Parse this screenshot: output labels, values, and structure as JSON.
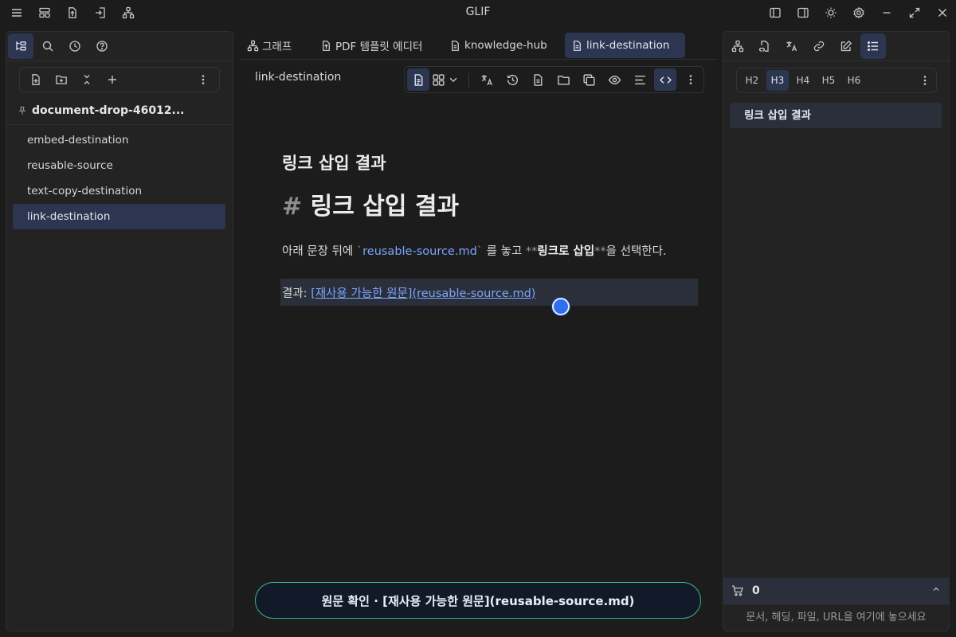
{
  "app": {
    "title": "GLIF"
  },
  "titlebar": {
    "left_icons": [
      "menu-icon",
      "layout-icon",
      "export-icon",
      "import-icon",
      "hierarchy-icon"
    ],
    "right_icons": [
      "left-sidebar-icon",
      "right-sidebar-icon",
      "theme-icon",
      "settings-icon",
      "minimize-icon",
      "maximize-icon",
      "close-icon"
    ]
  },
  "left_panel": {
    "tabs": [
      "file-tree-icon",
      "search-icon",
      "history-icon",
      "help-icon"
    ],
    "toolbar": [
      "new-file-icon",
      "new-folder-icon",
      "collapse-icon",
      "add-icon",
      "more-icon"
    ],
    "vault": {
      "name": "document-drop-46012..."
    },
    "files": [
      {
        "label": "embed-destination",
        "active": false
      },
      {
        "label": "reusable-source",
        "active": false
      },
      {
        "label": "text-copy-destination",
        "active": false
      },
      {
        "label": "link-destination",
        "active": true
      }
    ]
  },
  "tabs": [
    {
      "label": "그래프",
      "icon": "graph-icon",
      "active": false
    },
    {
      "label": "PDF 템플릿 에디터",
      "icon": "pdf-icon",
      "active": false
    },
    {
      "label": "knowledge-hub",
      "icon": "document-icon",
      "active": false
    },
    {
      "label": "link-destination",
      "icon": "document-icon",
      "active": true
    }
  ],
  "document": {
    "header_title": "link-destination",
    "toolbar": [
      "document-icon",
      "grid-icon",
      "chevron-down-icon",
      "translate-icon",
      "history-icon",
      "file-icon",
      "folder-icon",
      "copy-icon",
      "preview-icon",
      "align-icon",
      "code-icon",
      "more-icon"
    ],
    "h3": "링크 삽입 결과",
    "h1_hash": "#",
    "h1_text": "링크 삽입 결과",
    "para_before": "아래 문장 뒤에 ",
    "para_tick": "`",
    "para_code": "reusable-source.md",
    "para_mid": " 를 놓고 ",
    "para_mark": "**",
    "para_bold": "링크로 삽입",
    "para_after": "을 선택한다.",
    "result_label": "결과: ",
    "result_link_text": "[재사용 가능한 원문]",
    "result_link_url": "(reusable-source.md)"
  },
  "bottom_pill": {
    "label": "원문 확인 · [재사용 가능한 원문](reusable-source.md)"
  },
  "right_panel": {
    "tabs": [
      "graph-icon",
      "file-link-icon",
      "translate-icon",
      "link-icon",
      "edit-icon",
      "outline-icon"
    ],
    "headings": [
      "H2",
      "H3",
      "H4",
      "H5",
      "H6"
    ],
    "active_heading": "H3",
    "outline_items": [
      "링크 삽입 결과"
    ],
    "cart": {
      "count": "0"
    },
    "drop_placeholder": "문서, 헤딩, 파일, URL을 여기에 놓으세요"
  },
  "colors": {
    "accent": "#2c3650",
    "link": "#7aa6ff",
    "pill_border": "#36b37a",
    "cursor": "#2f6ef0"
  }
}
